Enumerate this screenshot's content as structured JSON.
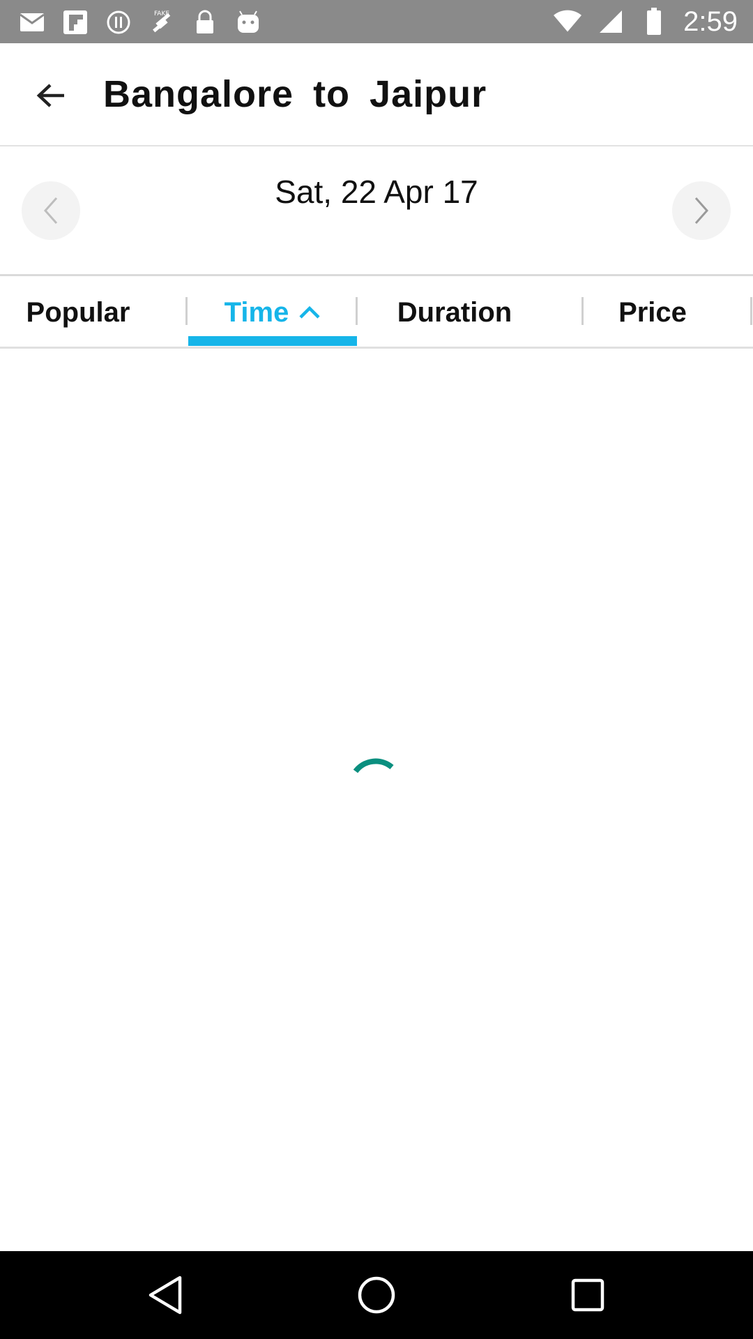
{
  "status_bar": {
    "time": "2:59",
    "icons": [
      "mail-icon",
      "flipboard-icon",
      "alert-icon",
      "fake-gps-icon",
      "lock-icon",
      "android-icon",
      "wifi-icon",
      "signal-icon",
      "battery-icon"
    ]
  },
  "header": {
    "title": "Bangalore  to  Jaipur",
    "back_icon": "arrow-back-icon"
  },
  "date_bar": {
    "date": "Sat, 22 Apr 17",
    "prev_icon": "chevron-left-icon",
    "next_icon": "chevron-right-icon"
  },
  "sort_tabs": {
    "items": [
      {
        "label": "Popular"
      },
      {
        "label": "Time",
        "selected": true,
        "sort_direction": "ascending"
      },
      {
        "label": "Duration"
      },
      {
        "label": "Price"
      }
    ]
  },
  "loading": {
    "icon": "loading-spinner-icon",
    "color": "#0a8f7f"
  },
  "colors": {
    "accent": "#16b5e9",
    "status_bar": "#8a8a8a",
    "nav_bar": "#000000"
  },
  "nav_bar": {
    "icons": [
      "back-triangle-icon",
      "home-circle-icon",
      "recents-square-icon"
    ]
  }
}
